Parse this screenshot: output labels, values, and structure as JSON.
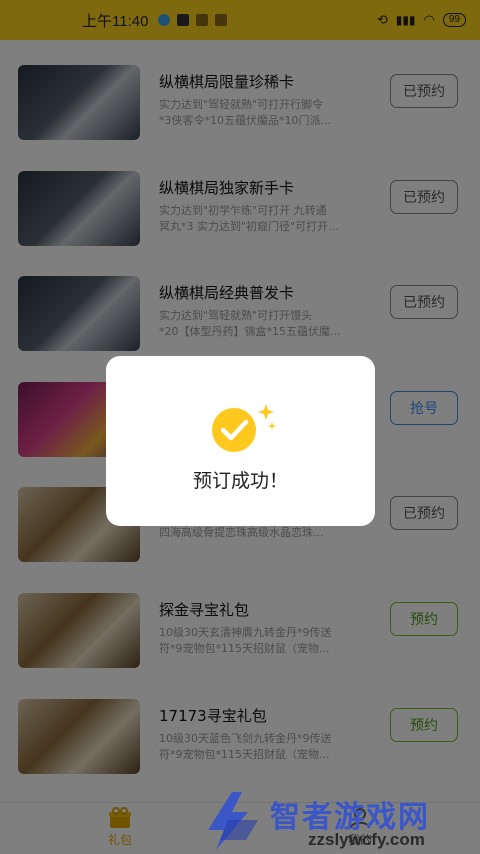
{
  "status_bar": {
    "time": "上午11:40",
    "battery": "99",
    "icons": [
      "notification-icon",
      "app-icon",
      "mail-icon",
      "download-icon",
      "rotate-icon",
      "signal-icon",
      "wifi-icon",
      "battery-icon"
    ]
  },
  "gift_list": {
    "items": [
      {
        "title": "纵横棋局限量珍稀卡",
        "desc_line1": "实力达到\"驾轻就熟\"可打开行脚令",
        "desc_line2": "*3侠客令*10五蕴伏魔品*10门派...",
        "button": "已预约",
        "button_state": "reserved",
        "thumb": "dark"
      },
      {
        "title": "纵横棋局独家新手卡",
        "desc_line1": "实力达到\"初学乍练\"可打开 九转通",
        "desc_line2": "冥丸*3 实力达到\"初窥门径\"可打开...",
        "button": "已预约",
        "button_state": "reserved",
        "thumb": "dark"
      },
      {
        "title": "纵横棋局经典普发卡",
        "desc_line1": "实力达到\"驾轻就熟\"可打开馒头",
        "desc_line2": "*20【体型丹药】锦盒*15五蕴伏魔...",
        "button": "已预约",
        "button_state": "reserved",
        "thumb": "dark"
      },
      {
        "title": "",
        "desc_line1": "",
        "desc_line2": "",
        "button": "抢号",
        "button_state": "grab",
        "thumb": "game"
      },
      {
        "title": "",
        "desc_line1": "",
        "desc_line2": "四海高级骨提恋珠高级水晶恋珠...",
        "button": "已预约",
        "button_state": "reserved",
        "thumb": "war"
      },
      {
        "title": "探金寻宝礼包",
        "desc_line1": "10级30天玄清神膺九转金丹*9传送",
        "desc_line2": "符*9宠物包*115天招财鼠（宠物...",
        "button": "预约",
        "button_state": "reserve",
        "thumb": "war"
      },
      {
        "title": "17173寻宝礼包",
        "desc_line1": "10级30天蓝色飞剑九转金丹*9传送",
        "desc_line2": "符*9宠物包*115天招财鼠（宠物...",
        "button": "预约",
        "button_state": "reserve",
        "thumb": "war"
      }
    ]
  },
  "tab_bar": {
    "tabs": [
      {
        "label": "礼包",
        "active": true
      },
      {
        "label": "我的",
        "active": false
      }
    ]
  },
  "dialog": {
    "message": "预订成功！",
    "icon": "check-circle-icon"
  },
  "watermark": {
    "title": "智者游戏网",
    "url": "zzslywcfy.com"
  },
  "colors": {
    "accent": "#ffd21f",
    "grab_blue": "#3b8df2",
    "reserve_green": "#6fba2c",
    "check_yellow": "#ffc81e",
    "watermark_blue": "#3a56c8"
  }
}
